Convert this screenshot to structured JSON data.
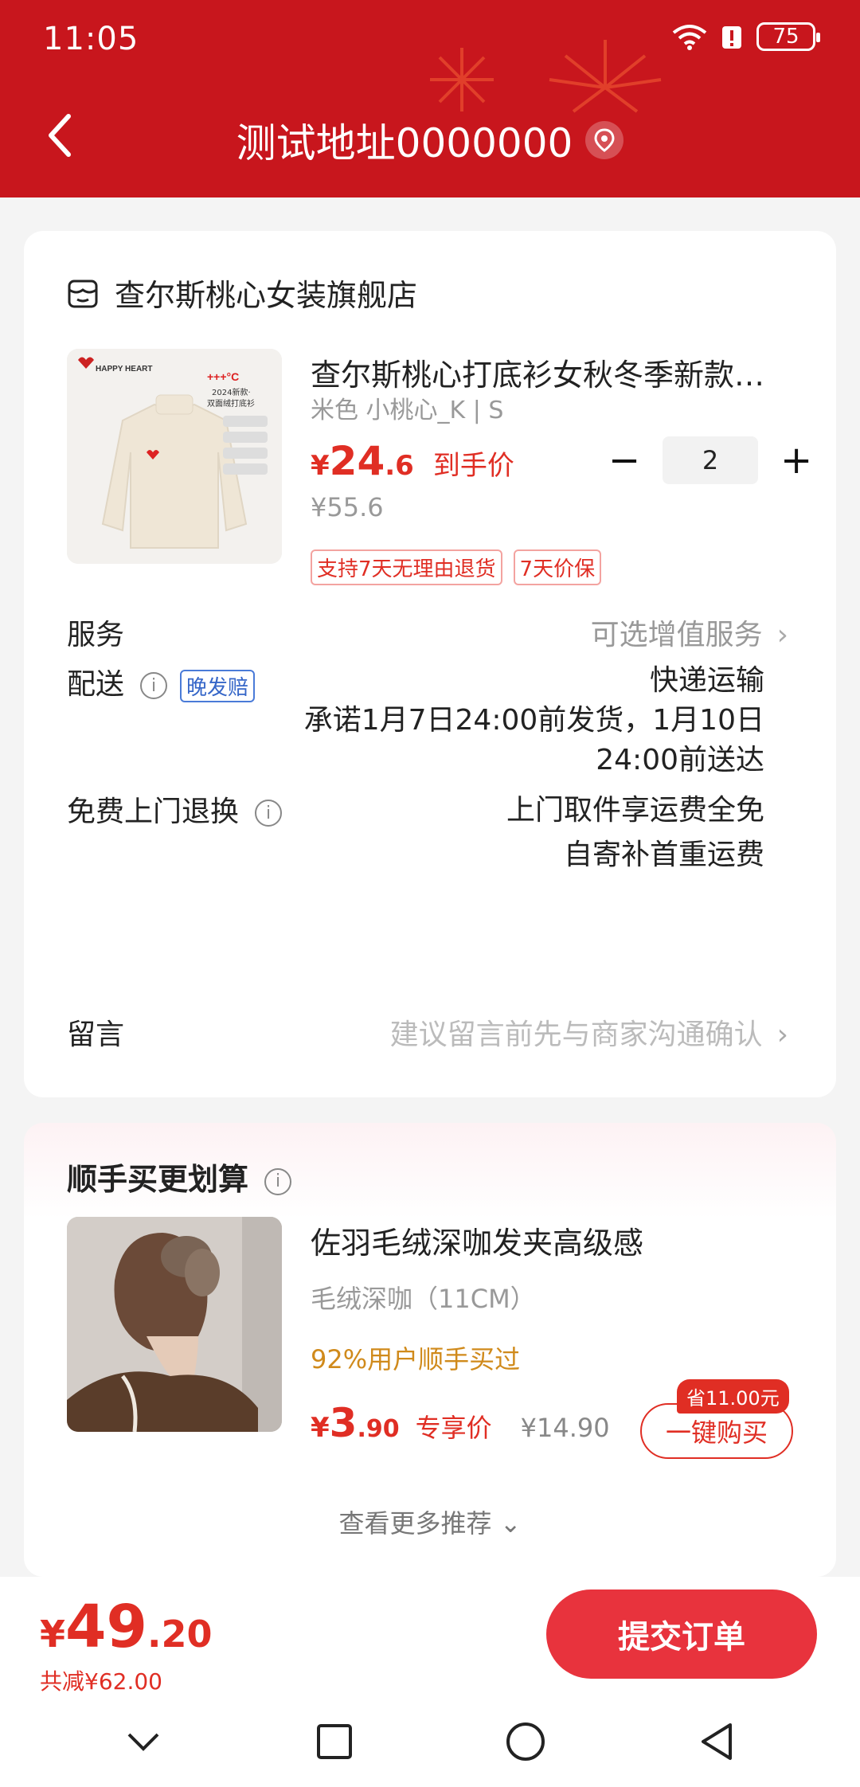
{
  "status_bar": {
    "time": "11:05",
    "battery": "75"
  },
  "header": {
    "title": "测试地址0000000"
  },
  "store": {
    "name": "查尔斯桃心女装旗舰店"
  },
  "product": {
    "title": "查尔斯桃心打底衫女秋冬季新款…",
    "sku": "米色 小桃心_K | S",
    "price_currency": "¥",
    "price_int": "24",
    "price_dec": ".6",
    "price_label": "到手价",
    "original_price": "¥55.6",
    "quantity": "2",
    "tags": [
      "支持7天无理由退货",
      "7天价保"
    ],
    "image_text": {
      "brand": "HAPPY HEART",
      "temp": "+++°C",
      "line1": "2024新款·",
      "line2": "双面绒打底衫"
    }
  },
  "service": {
    "label": "服务",
    "value": "可选增值服务"
  },
  "delivery": {
    "label": "配送",
    "badge": "晚发赔",
    "method": "快递运输",
    "promise_line1": "承诺1月7日24:00前发货，1月10日",
    "promise_line2": "24:00前送达"
  },
  "return": {
    "label": "免费上门退换",
    "line1": "上门取件享运费全免",
    "line2": "自寄补首重运费"
  },
  "note": {
    "label": "留言",
    "placeholder": "建议留言前先与商家沟通确认"
  },
  "recommend": {
    "title": "顺手买更划算",
    "item": {
      "title": "佐羽毛绒深咖发夹高级感",
      "sku": "毛绒深咖（11CM）",
      "social": "92%用户顺手买过",
      "price_currency": "¥",
      "price_int": "3",
      "price_dec": ".90",
      "price_label": "专享价",
      "original_price": "¥14.90",
      "save_badge": "省11.00元",
      "buy_label": "一键购买"
    },
    "more_label": "查看更多推荐"
  },
  "footer": {
    "total_currency": "¥",
    "total_int": "49",
    "total_dec": ".20",
    "discount": "共减¥62.00",
    "submit_label": "提交订单"
  }
}
